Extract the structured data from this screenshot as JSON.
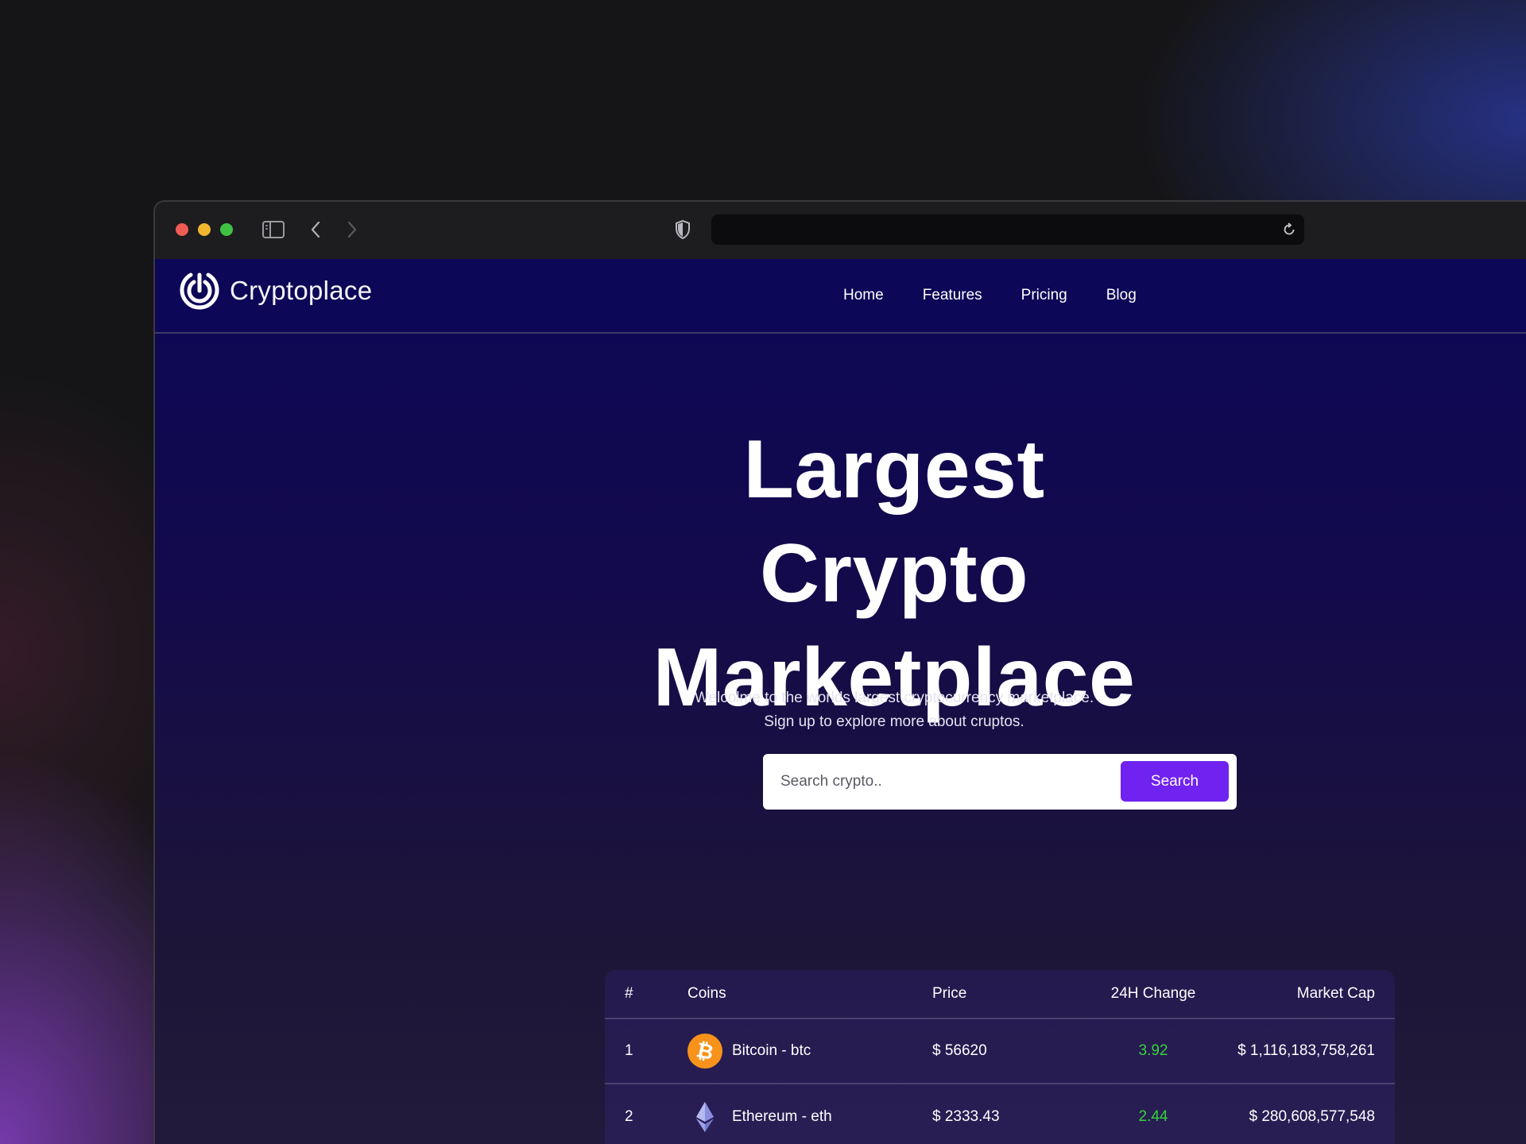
{
  "app": {
    "name": "Cryptoplace"
  },
  "nav": {
    "links": [
      "Home",
      "Features",
      "Pricing",
      "Blog"
    ]
  },
  "hero": {
    "title_line1": "Largest",
    "title_line2": "Crypto",
    "title_line3": "Marketplace",
    "subtitle_line1": "Welcolme to the worlds largest cryptocurrency marketplace.",
    "subtitle_line2": "Sign up to explore more about cruptos."
  },
  "search": {
    "placeholder": "Search crypto..",
    "button_label": "Search"
  },
  "table": {
    "headers": [
      "#",
      "Coins",
      "Price",
      "24H Change",
      "Market Cap"
    ],
    "rows": [
      {
        "rank": "1",
        "coin": "Bitcoin - btc",
        "icon": "bitcoin-icon",
        "price": "$ 56620",
        "change": "3.92",
        "market_cap": "$ 1,116,183,758,261"
      },
      {
        "rank": "2",
        "coin": "Ethereum - eth",
        "icon": "ethereum-icon",
        "price": "$ 2333.43",
        "change": "2.44",
        "market_cap": "$ 280,608,577,548"
      }
    ]
  },
  "colors": {
    "accent": "#7022f0",
    "positive": "#35d33a",
    "nav_bg": "#0c0757"
  }
}
